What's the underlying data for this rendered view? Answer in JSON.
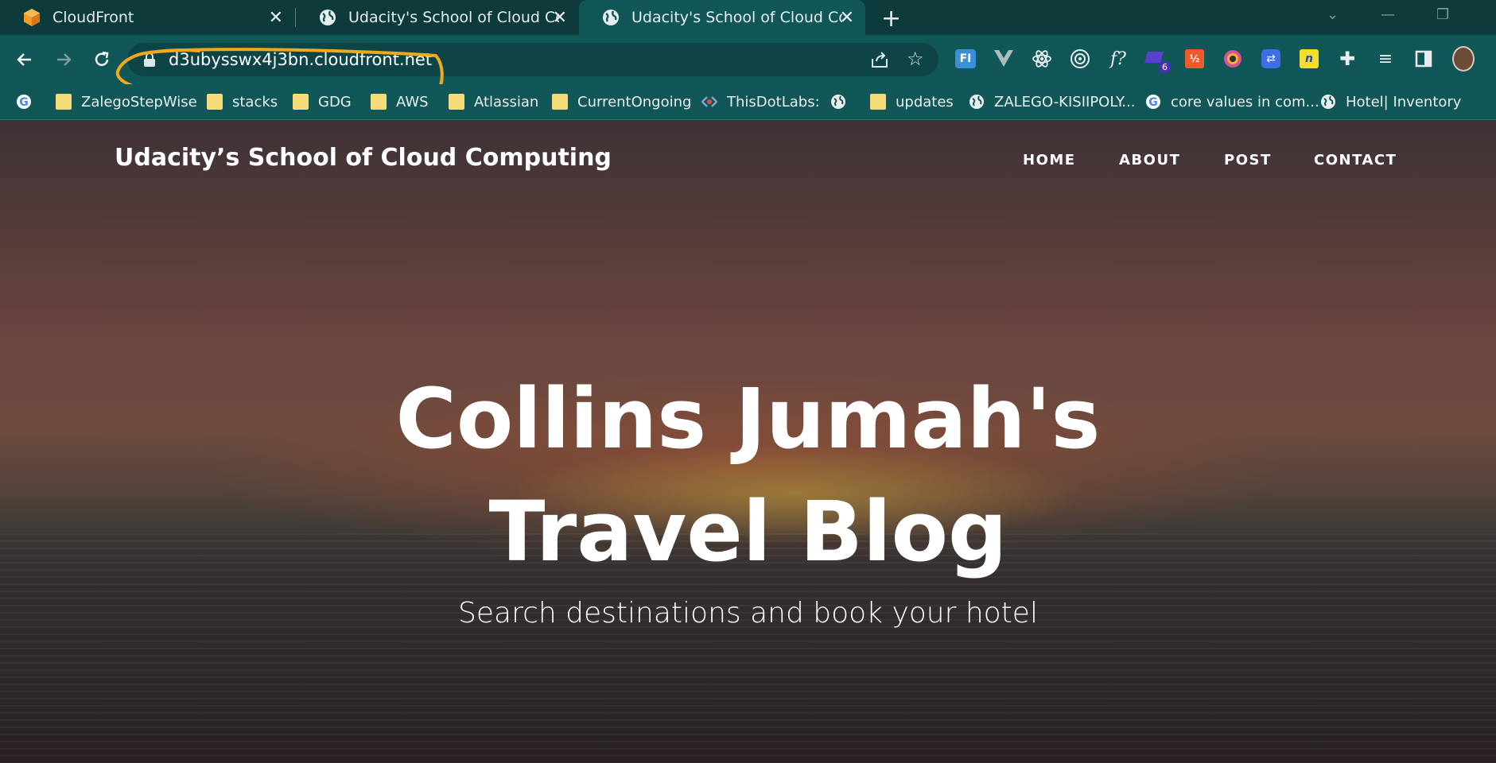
{
  "browser": {
    "tabs": [
      {
        "title": "CloudFront",
        "icon": "aws-cube-icon"
      },
      {
        "title": "Udacity's School of Cloud Compu",
        "icon": "globe-icon"
      },
      {
        "title": "Udacity's School of Cloud Comp",
        "icon": "globe-icon",
        "active": true
      }
    ],
    "address": "d3ubysswx4j3bn.cloudfront.net",
    "extensions_badge": "6",
    "bookmarks": [
      {
        "label": "",
        "icon": "google-icon"
      },
      {
        "label": "ZalegoStepWise",
        "icon": "folder-icon"
      },
      {
        "label": "stacks",
        "icon": "folder-icon"
      },
      {
        "label": "GDG",
        "icon": "folder-icon"
      },
      {
        "label": "AWS",
        "icon": "folder-icon"
      },
      {
        "label": "Atlassian",
        "icon": "folder-icon"
      },
      {
        "label": "CurrentOngoing",
        "icon": "folder-icon"
      },
      {
        "label": "ThisDotLabs:",
        "icon": "thisdot-icon"
      },
      {
        "label": "",
        "icon": "globe-icon"
      },
      {
        "label": "updates",
        "icon": "folder-icon"
      },
      {
        "label": "ZALEGO-KISIIPOLY...",
        "icon": "globe-icon"
      },
      {
        "label": "core values in com...",
        "icon": "google-icon"
      },
      {
        "label": "Hotel| Inventory",
        "icon": "globe-icon"
      }
    ]
  },
  "site": {
    "brand": "Udacity’s School of Cloud Computing",
    "nav": [
      "HOME",
      "ABOUT",
      "POST",
      "CONTACT"
    ],
    "hero_line1": "Collins Jumah's",
    "hero_line2": "Travel Blog",
    "hero_subtitle": "Search destinations and book your hotel"
  },
  "colors": {
    "tabstrip": "#0d3b3c",
    "toolbar": "#125758",
    "annotation": "#f2a81d"
  }
}
